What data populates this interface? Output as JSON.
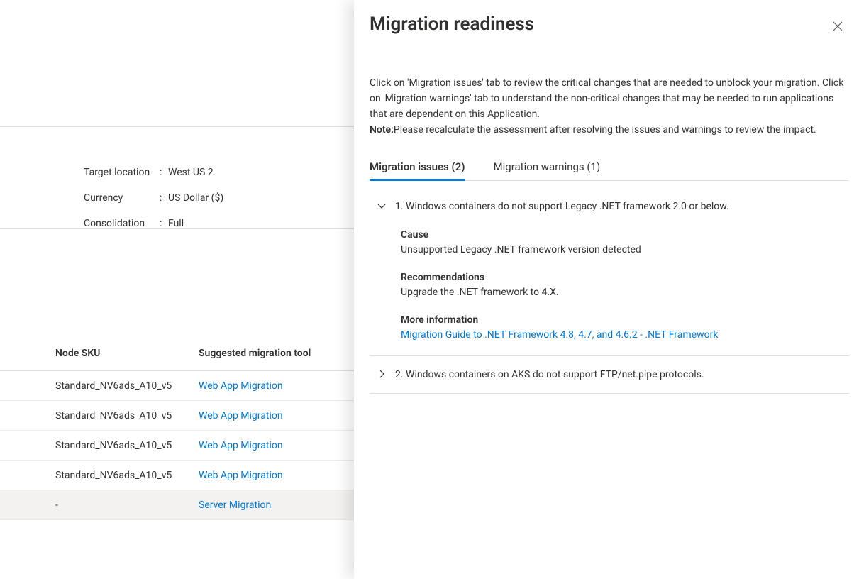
{
  "meta": {
    "target_location_label": "Target location",
    "target_location_value": "West US 2",
    "currency_label": "Currency",
    "currency_value": "US Dollar ($)",
    "consolidation_label": "Consolidation",
    "consolidation_value": "Full"
  },
  "table": {
    "headers": {
      "sku": "Node SKU",
      "tool": "Suggested migration tool"
    },
    "rows": [
      {
        "sku": "Standard_NV6ads_A10_v5",
        "tool": "Web App Migration"
      },
      {
        "sku": "Standard_NV6ads_A10_v5",
        "tool": "Web App Migration"
      },
      {
        "sku": "Standard_NV6ads_A10_v5",
        "tool": "Web App Migration"
      },
      {
        "sku": "Standard_NV6ads_A10_v5",
        "tool": "Web App Migration"
      },
      {
        "sku": "-",
        "tool": "Server Migration"
      }
    ]
  },
  "panel": {
    "title": "Migration readiness",
    "description": "Click on 'Migration issues' tab to review the critical changes that are needed to unblock your migration. Click on 'Migration warnings' tab to understand the non-critical changes that may be needed to run applications that are dependent on this Application.",
    "note_label": "Note:",
    "note_text": "Please recalculate the assessment after resolving the issues and warnings to review the impact.",
    "tabs": {
      "issues": "Migration issues (2)",
      "warnings": "Migration warnings (1)"
    },
    "issues": [
      {
        "title": "1. Windows containers do not support Legacy .NET framework 2.0 or below.",
        "expanded": true,
        "cause_label": "Cause",
        "cause_text": "Unsupported Legacy .NET framework version detected",
        "rec_label": "Recommendations",
        "rec_text": "Upgrade the .NET framework to 4.X.",
        "more_label": "More information",
        "more_link": "Migration Guide to .NET Framework 4.8, 4.7, and 4.6.2 - .NET Framework"
      },
      {
        "title": "2. Windows containers on AKS do not support FTP/net.pipe protocols.",
        "expanded": false
      }
    ]
  }
}
